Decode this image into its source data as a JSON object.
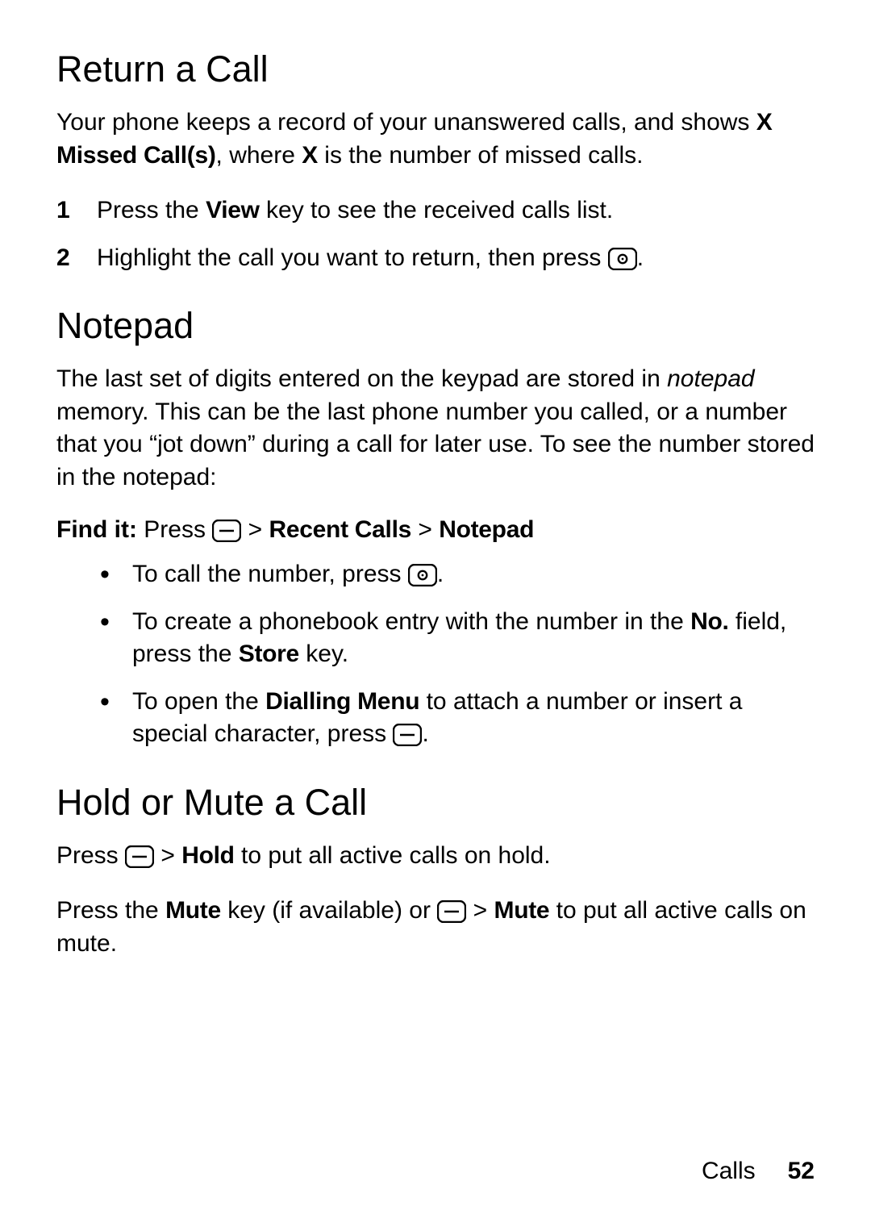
{
  "sections": {
    "return_call": {
      "heading": "Return a Call",
      "intro_pre": "Your phone keeps a record of your unanswered calls, and shows ",
      "intro_bold": "X Missed Call(s)",
      "intro_mid": ", where ",
      "intro_bold2": "X",
      "intro_post": " is the number of missed calls.",
      "step1_pre": "Press the ",
      "step1_bold": "View",
      "step1_post": " key to see the received calls list.",
      "step2_pre": "Highlight the call you want to return, then press ",
      "step2_post": "."
    },
    "notepad": {
      "heading": "Notepad",
      "intro_a": "The last set of digits entered on the keypad are stored in ",
      "intro_em": "notepad",
      "intro_b": " memory. This can be the last phone number you called, or a number that you “jot down” during a call for later use. To see the number stored in the notepad:",
      "findit_label": "Find it: ",
      "findit_press": "Press ",
      "findit_sep1": " > ",
      "findit_recent": "Recent Calls",
      "findit_sep2": " > ",
      "findit_notepad": "Notepad",
      "b1_pre": "To call the number, press ",
      "b1_post": ".",
      "b2_a": "To create a phonebook entry with the number in the ",
      "b2_no": "No.",
      "b2_b": " field, press the ",
      "b2_store": "Store",
      "b2_c": " key.",
      "b3_a": "To open the ",
      "b3_dm": "Dialling Menu",
      "b3_b": " to attach a number or insert a special character, press ",
      "b3_c": "."
    },
    "hold_mute": {
      "heading": "Hold or Mute a Call",
      "p1_a": "Press ",
      "p1_sep": " > ",
      "p1_hold": "Hold",
      "p1_b": " to put all active calls on hold.",
      "p2_a": "Press the ",
      "p2_mute": "Mute",
      "p2_b": " key (if available) or ",
      "p2_sep": " > ",
      "p2_mute2": "Mute",
      "p2_c": " to put all active calls on mute."
    }
  },
  "footer": {
    "section": "Calls",
    "page": "52"
  },
  "icons": {
    "menu_key": "menu-key-icon",
    "call_key": "call-key-icon"
  }
}
